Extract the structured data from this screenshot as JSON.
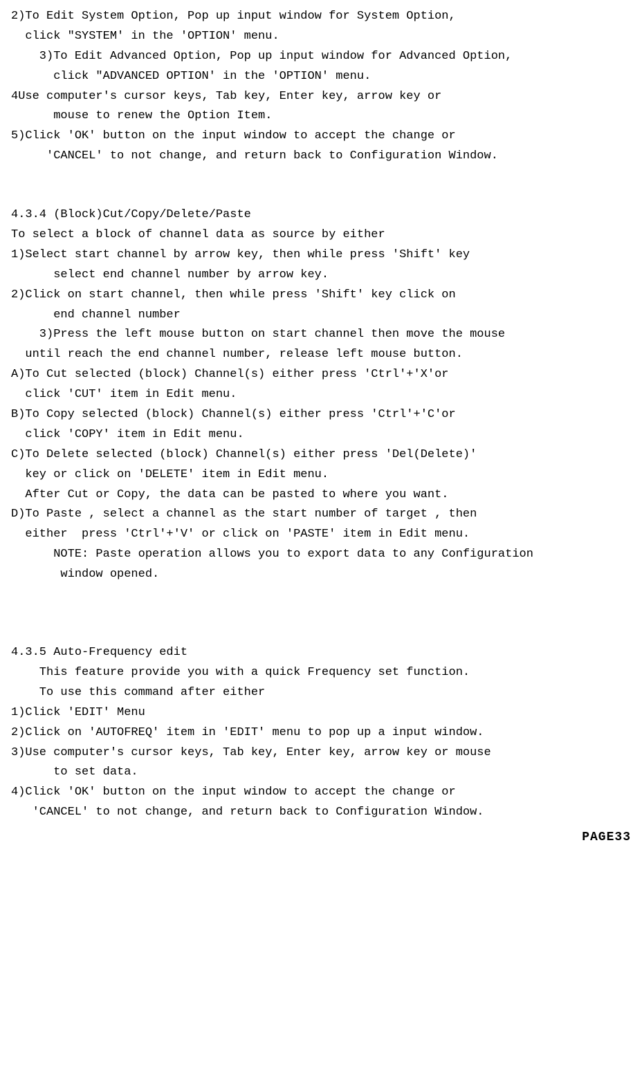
{
  "lines": [
    "2)To Edit System Option, Pop up input window for System Option,",
    "  click \"SYSTEM' in the 'OPTION' menu.",
    "    3)To Edit Advanced Option, Pop up input window for Advanced Option,",
    "      click \"ADVANCED OPTION' in the 'OPTION' menu.",
    "4Use computer's cursor keys, Tab key, Enter key, arrow key or",
    "      mouse to renew the Option Item.",
    "5)Click 'OK' button on the input window to accept the change or",
    "     'CANCEL' to not change, and return back to Configuration Window.",
    "",
    "",
    "4.3.4 (Block)Cut/Copy/Delete/Paste",
    "To select a block of channel data as source by either",
    "1)Select start channel by arrow key, then while press 'Shift' key",
    "      select end channel number by arrow key.",
    "2)Click on start channel, then while press 'Shift' key click on",
    "      end channel number",
    "    3)Press the left mouse button on start channel then move the mouse",
    "  until reach the end channel number, release left mouse button.",
    "A)To Cut selected (block) Channel(s) either press 'Ctrl'+'X'or",
    "  click 'CUT' item in Edit menu.",
    "B)To Copy selected (block) Channel(s) either press 'Ctrl'+'C'or",
    "  click 'COPY' item in Edit menu.",
    "C)To Delete selected (block) Channel(s) either press 'Del(Delete)'",
    "  key or click on 'DELETE' item in Edit menu.",
    "  After Cut or Copy, the data can be pasted to where you want.",
    "D)To Paste , select a channel as the start number of target , then",
    "  either  press 'Ctrl'+'V' or click on 'PASTE' item in Edit menu.",
    "      NOTE: Paste operation allows you to export data to any Configuration",
    "       window opened.",
    "",
    "",
    "",
    "4.3.5 Auto-Frequency edit",
    "    This feature provide you with a quick Frequency set function.",
    "    To use this command after either",
    "1)Click 'EDIT' Menu",
    "2)Click on 'AUTOFREQ' item in 'EDIT' menu to pop up a input window.",
    "3)Use computer's cursor keys, Tab key, Enter key, arrow key or mouse",
    "      to set data.",
    "4)Click 'OK' button on the input window to accept the change or",
    "   'CANCEL' to not change, and return back to Configuration Window."
  ],
  "pageLabel": "PAGE33"
}
